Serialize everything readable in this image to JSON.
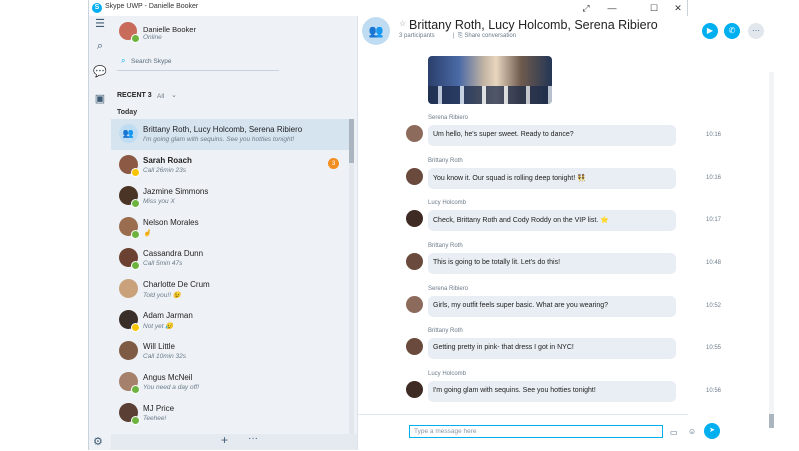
{
  "window": {
    "title": "Skype UWP - Danielle Booker",
    "logo_letter": "S",
    "controls": [
      "⤢",
      "—",
      "☐",
      "✕"
    ]
  },
  "rail": {
    "icons": [
      "hamburger-icon",
      "search-icon",
      "chat-icon",
      "contacts-icon",
      "gear-icon"
    ]
  },
  "profile": {
    "name": "Danielle Booker",
    "status": "Online"
  },
  "search": {
    "placeholder": "Search Skype"
  },
  "recent": {
    "heading": "RECENT 3",
    "filter": "All",
    "section": "Today"
  },
  "contacts": [
    {
      "name": "Brittany Roth, Lucy Holcomb, Serena Ribiero",
      "sub": "I'm going glam with sequins. See you hotties tonight!",
      "group": true,
      "selected": true,
      "bold": false
    },
    {
      "name": "Sarah Roach",
      "sub": "Call 26min 23s",
      "badge": "3",
      "bold": true,
      "presence": "away",
      "color": "#8c5a44"
    },
    {
      "name": "Jazmine Simmons",
      "sub": "Miss you X",
      "presence": "on",
      "color": "#4a3426"
    },
    {
      "name": "Nelson Morales",
      "sub": "🤞",
      "presence": "on",
      "color": "#9b6d4f"
    },
    {
      "name": "Cassandra Dunn",
      "sub": "Call 5min 47s",
      "presence": "on",
      "color": "#6b4131"
    },
    {
      "name": "Charlotte De Crum",
      "sub": "Told you!! 😉",
      "presence": "none",
      "color": "#c9a27c"
    },
    {
      "name": "Adam Jarman",
      "sub": "Not yet 😥",
      "presence": "away",
      "color": "#3a2e28"
    },
    {
      "name": "Will Little",
      "sub": "Call 10min 32s",
      "presence": "none",
      "color": "#7e5b45"
    },
    {
      "name": "Angus McNeil",
      "sub": "You need a day off!",
      "presence": "on",
      "color": "#a5806a"
    },
    {
      "name": "MJ Price",
      "sub": "Teehee!",
      "presence": "on",
      "color": "#5a3f34"
    }
  ],
  "chat": {
    "title": "Brittany Roth, Lucy Holcomb, Serena Ribiero",
    "participants": "3 participants",
    "share": "Share conversation",
    "messages": [
      {
        "sender": "Serena Ribiero",
        "text": "Um hello, he's super sweet. Ready to dance?",
        "time": "10:16",
        "color": "#8d6b5c"
      },
      {
        "sender": "Brittany Roth",
        "text": "You know it. Our squad is rolling deep tonight! 👯",
        "time": "10:16",
        "color": "#6a4a3c"
      },
      {
        "sender": "Lucy Holcomb",
        "text": "Check, Brittany Roth and Cody Roddy on the VIP list. ⭐",
        "time": "10:17",
        "color": "#3d2b24"
      },
      {
        "sender": "Brittany Roth",
        "text": "This is going to be totally lit. Let's do this!",
        "time": "10:48",
        "color": "#6a4a3c"
      },
      {
        "sender": "Serena Ribiero",
        "text": "Girls, my outfit feels super basic. What are you wearing?",
        "time": "10:52",
        "color": "#8d6b5c"
      },
      {
        "sender": "Brittany Roth",
        "text": "Getting pretty in pink- that dress I got in NYC!",
        "time": "10:55",
        "color": "#6a4a3c"
      },
      {
        "sender": "Lucy Holcomb",
        "text": "I'm going glam with sequins. See you hotties tonight!",
        "time": "10:56",
        "color": "#3d2b24"
      }
    ],
    "compose_placeholder": "Type a message here"
  },
  "colors": {
    "accent": "#00aff0",
    "online": "#6cb33f",
    "away": "#f8c400",
    "badge": "#f28d21",
    "sidebar": "#eef2f6"
  }
}
